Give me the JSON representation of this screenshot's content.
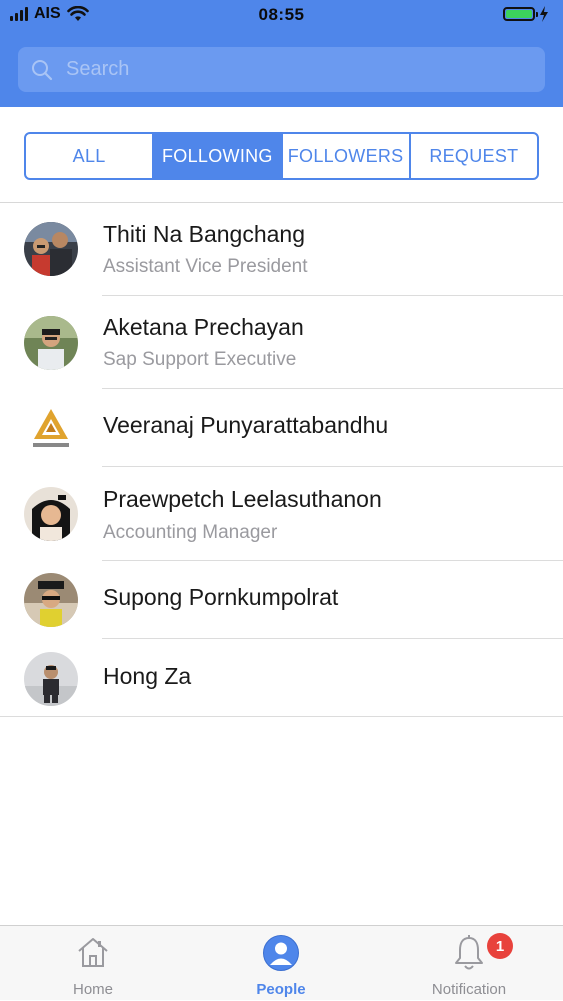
{
  "status_bar": {
    "carrier": "AIS",
    "time": "08:55",
    "battery_level": 1.0
  },
  "search": {
    "placeholder": "Search"
  },
  "tabs": [
    {
      "label": "ALL",
      "active": false
    },
    {
      "label": "FOLLOWING",
      "active": true
    },
    {
      "label": "FOLLOWERS",
      "active": false
    },
    {
      "label": "REQUEST",
      "active": false
    }
  ],
  "people": [
    {
      "name": "Thiti Na Bangchang",
      "title": "Assistant Vice President",
      "avatar": "photo"
    },
    {
      "name": "Aketana Prechayan",
      "title": "Sap Support Executive",
      "avatar": "photo"
    },
    {
      "name": "Veeranaj Punyarattabandhu",
      "title": "",
      "avatar": "tcc-group-logo"
    },
    {
      "name": "Praewpetch Leelasuthanon",
      "title": "Accounting Manager",
      "avatar": "photo"
    },
    {
      "name": "Supong Pornkumpolrat",
      "title": "",
      "avatar": "photo"
    },
    {
      "name": "Hong Za",
      "title": "",
      "avatar": "photo"
    }
  ],
  "tabbar": {
    "home_label": "Home",
    "people_label": "People",
    "notification_label": "Notification",
    "notification_badge": "1"
  },
  "colors": {
    "accent": "#4f86ea",
    "badge": "#e8423c"
  },
  "icons": {
    "search": "search-icon",
    "home": "home-icon",
    "people": "person-icon",
    "notification": "bell-icon"
  }
}
